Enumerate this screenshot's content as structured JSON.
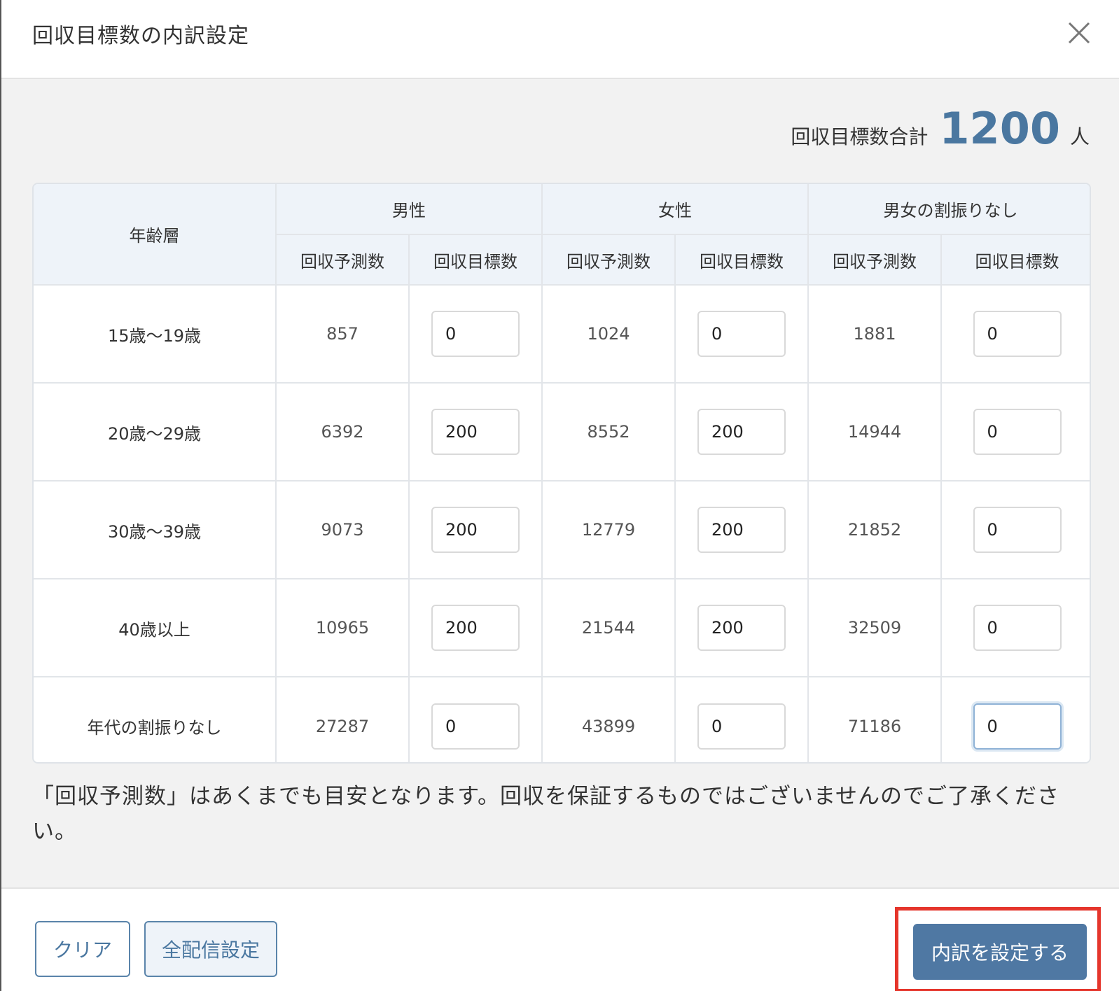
{
  "modal": {
    "title": "回収目標数の内訳設定"
  },
  "summary": {
    "label": "回収目標数合計",
    "value": "1200",
    "unit": "人"
  },
  "table": {
    "age_header": "年齢層",
    "groups": [
      "男性",
      "女性",
      "男女の割振りなし"
    ],
    "sub_headers": [
      "回収予測数",
      "回収目標数"
    ],
    "rows": [
      {
        "age": "15歳〜19歳",
        "cells": [
          {
            "forecast": "857",
            "target": "0"
          },
          {
            "forecast": "1024",
            "target": "0"
          },
          {
            "forecast": "1881",
            "target": "0"
          }
        ]
      },
      {
        "age": "20歳〜29歳",
        "cells": [
          {
            "forecast": "6392",
            "target": "200"
          },
          {
            "forecast": "8552",
            "target": "200"
          },
          {
            "forecast": "14944",
            "target": "0"
          }
        ]
      },
      {
        "age": "30歳〜39歳",
        "cells": [
          {
            "forecast": "9073",
            "target": "200"
          },
          {
            "forecast": "12779",
            "target": "200"
          },
          {
            "forecast": "21852",
            "target": "0"
          }
        ]
      },
      {
        "age": "40歳以上",
        "cells": [
          {
            "forecast": "10965",
            "target": "200"
          },
          {
            "forecast": "21544",
            "target": "200"
          },
          {
            "forecast": "32509",
            "target": "0"
          }
        ]
      },
      {
        "age": "年代の割振りなし",
        "cells": [
          {
            "forecast": "27287",
            "target": "0"
          },
          {
            "forecast": "43899",
            "target": "0"
          },
          {
            "forecast": "71186",
            "target": "0"
          }
        ]
      }
    ]
  },
  "note": "「回収予測数」はあくまでも目安となります。回収を保証するものではございませんのでご了承ください。",
  "footer": {
    "clear_label": "クリア",
    "all_delivery_label": "全配信設定",
    "submit_label": "内訳を設定する"
  },
  "colors": {
    "accent": "#4a77a0",
    "primary_button": "#4f78a3",
    "header_bg": "#eef3f9",
    "highlight": "#e5352b"
  },
  "icons": {
    "close": "close-icon"
  }
}
